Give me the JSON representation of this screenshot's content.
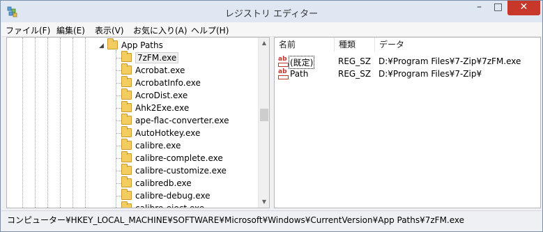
{
  "window": {
    "title": "レジストリ エディター",
    "app_icon": "regedit-icon"
  },
  "titlebar_buttons": {
    "minimize": "–",
    "maximize": "□",
    "close": "✕"
  },
  "menu": {
    "items": [
      "ファイル(F)",
      "編集(E)",
      "表示(V)",
      "お気に入り(A)",
      "ヘルプ(H)"
    ]
  },
  "tree": {
    "parent": {
      "label": "App Paths",
      "expander": "◢"
    },
    "children": [
      "7zFM.exe",
      "Acrobat.exe",
      "AcrobatInfo.exe",
      "AcroDist.exe",
      "Ahk2Exe.exe",
      "ape-flac-converter.exe",
      "AutoHotkey.exe",
      "calibre.exe",
      "calibre-complete.exe",
      "calibre-customize.exe",
      "calibredb.exe",
      "calibre-debug.exe",
      "calibre-eject.exe"
    ],
    "selected_index": 0
  },
  "list": {
    "headers": {
      "name": "名前",
      "type": "種類",
      "data": "データ"
    },
    "rows": [
      {
        "name": "(既定)",
        "type": "REG_SZ",
        "data": "D:¥Program Files¥7-Zip¥7zFM.exe",
        "icon": "ab-string-icon"
      },
      {
        "name": "Path",
        "type": "REG_SZ",
        "data": "D:¥Program Files¥7-Zip¥",
        "icon": "ab-string-icon"
      }
    ]
  },
  "status": {
    "path": "コンピューター¥HKEY_LOCAL_MACHINE¥SOFTWARE¥Microsoft¥Windows¥CurrentVersion¥App Paths¥7zFM.exe"
  },
  "colors": {
    "selection_bg": "#f0f0f0",
    "folder": "#f3cd5f",
    "string_icon": "#c0362c",
    "close_button": "#c7372a"
  }
}
